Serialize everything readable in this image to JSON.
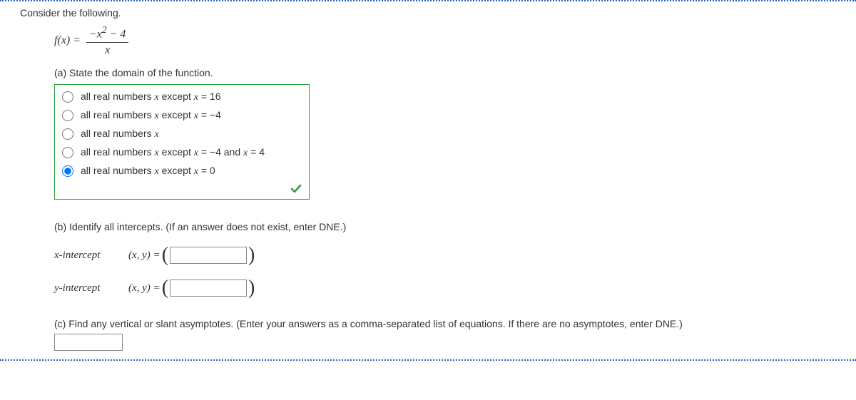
{
  "intro": "Consider the following.",
  "formula": {
    "lhs": "f(x) = ",
    "numerator_prefix": "−",
    "numerator_var": "x",
    "numerator_exp": "2",
    "numerator_suffix": " − 4",
    "denominator": "x"
  },
  "partA": {
    "prompt": "(a) State the domain of the function.",
    "options": [
      {
        "prefix": "all real numbers ",
        "var": "x",
        "mid": " except ",
        "var2": "x",
        "suffix": " = 16"
      },
      {
        "prefix": "all real numbers ",
        "var": "x",
        "mid": " except ",
        "var2": "x",
        "suffix": " = −4"
      },
      {
        "prefix": "all real numbers ",
        "var": "x",
        "mid": "",
        "var2": "",
        "suffix": ""
      },
      {
        "prefix": "all real numbers ",
        "var": "x",
        "mid": " except ",
        "var2": "x",
        "suffix": " = −4 and ",
        "var3": "x",
        "suffix2": " = 4"
      },
      {
        "prefix": "all real numbers ",
        "var": "x",
        "mid": " except ",
        "var2": "x",
        "suffix": " = 0"
      }
    ],
    "selected": 4
  },
  "partB": {
    "prompt": "(b) Identify all intercepts. (If an answer does not exist, enter DNE.)",
    "rows": [
      {
        "label": "x-intercept",
        "eq": "(x, y) = "
      },
      {
        "label": "y-intercept",
        "eq": "(x, y) = "
      }
    ]
  },
  "partC": {
    "prompt": "(c) Find any vertical or slant asymptotes. (Enter your answers as a comma-separated list of equations. If there are no asymptotes, enter DNE.)"
  }
}
